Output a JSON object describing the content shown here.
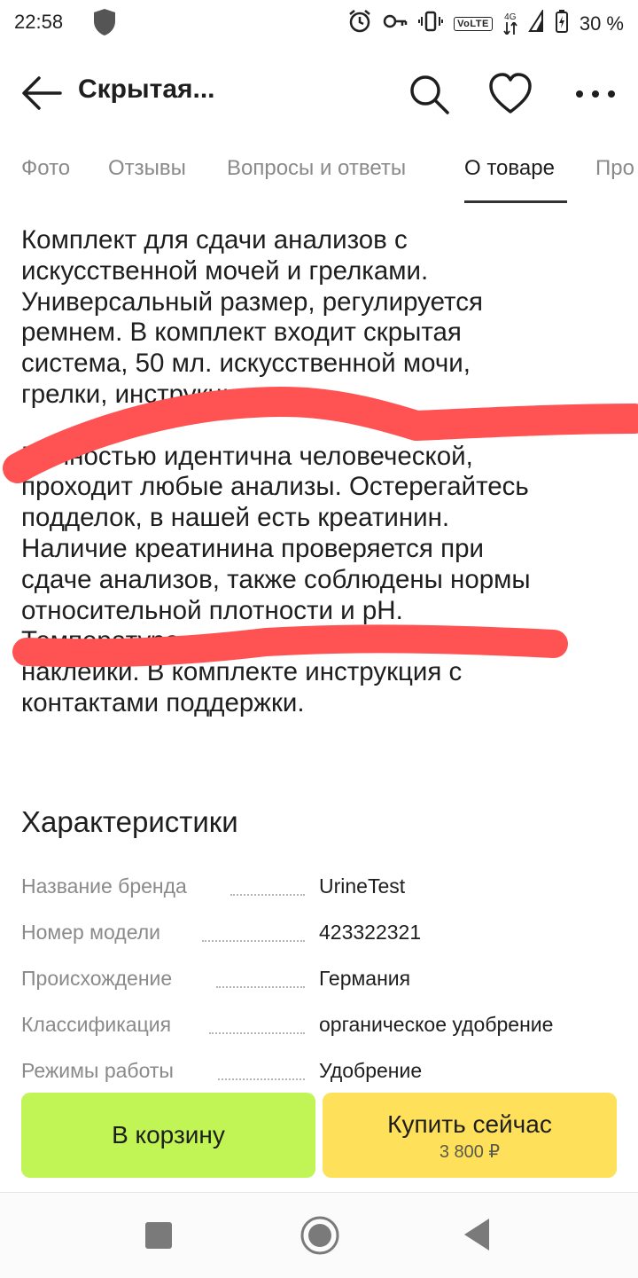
{
  "status_bar": {
    "time": "22:58",
    "network_badge": "VoLTE",
    "network_gen": "4G",
    "battery_percent": "30 %",
    "icons": [
      "shield-icon",
      "alarm-icon",
      "key-icon",
      "vibrate-icon",
      "signal-icon",
      "battery-icon"
    ]
  },
  "app_bar": {
    "title": "Скрытая...",
    "icons": [
      "back-arrow-icon",
      "search-icon",
      "heart-icon",
      "more-icon"
    ]
  },
  "tabs": [
    {
      "label": "Фото",
      "active": false
    },
    {
      "label": "Отзывы",
      "active": false
    },
    {
      "label": "Вопросы и ответы",
      "active": false
    },
    {
      "label": "О товаре",
      "active": true
    },
    {
      "label": "Про",
      "active": false
    }
  ],
  "description": {
    "paragraph1_lines": [
      "Комплект для сдачи анализов с",
      "искусственной мочей и грелками.",
      "Универсальный размер, регулируется",
      "ремнем. В комплект входит скрытая",
      "система, 50 мл. искусственной мочи,",
      "грелки, инструкция"
    ],
    "paragraph2_lines": [
      "Полностью идентична человеческой,",
      "проходит любые анализы. Остерегайтесь",
      "подделок, в нашей есть креатинин.",
      "Наличие креатинина проверяется при",
      "сдаче анализов, также соблюдены нормы",
      "относительной плотности и pH.",
      "Температура",
      "наклейки. В комплекте инструкция с",
      "контактами поддержки."
    ]
  },
  "characteristics": {
    "title": "Характеристики",
    "rows": [
      {
        "label": "Название бренда",
        "value": "UrineTest"
      },
      {
        "label": "Номер модели",
        "value": "423322321"
      },
      {
        "label": "Происхождение",
        "value": "Германия"
      },
      {
        "label": "Классификация",
        "value": "органическое удобрение"
      },
      {
        "label": "Режимы работы",
        "value": "Удобрение"
      }
    ]
  },
  "actions": {
    "cart_label": "В корзину",
    "buy_label": "Купить сейчас",
    "buy_price": "3 800 ₽",
    "cart_color": "#c1f555",
    "buy_color": "#ffe05b"
  },
  "colors": {
    "scribble": "#ff5353",
    "muted_text": "#8a8a8a"
  },
  "nav_bar": {
    "icons": [
      "recents-icon",
      "home-icon",
      "back-icon"
    ]
  }
}
